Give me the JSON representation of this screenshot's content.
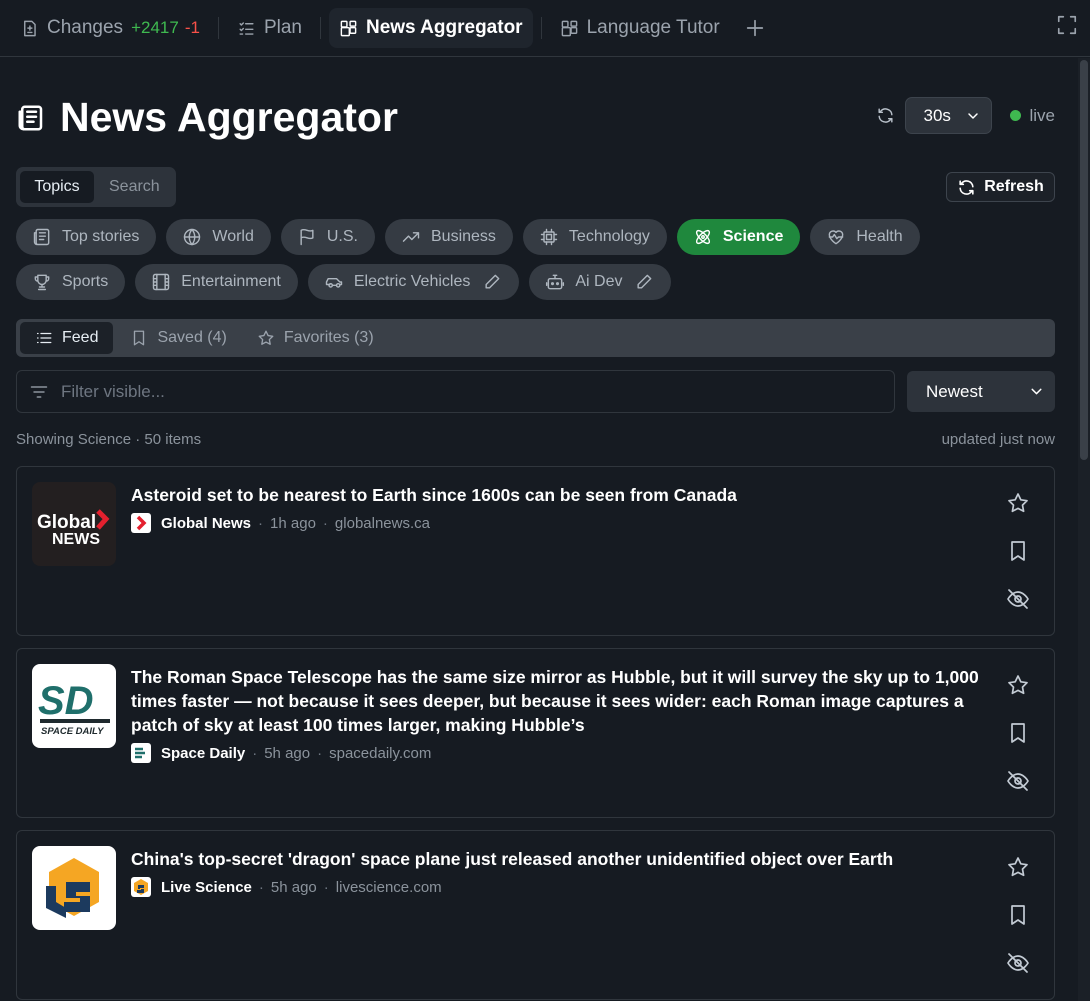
{
  "tabs": [
    {
      "label": "Changes",
      "additions": "+2417",
      "deletions": "-1"
    },
    {
      "label": "Plan"
    },
    {
      "label": "News Aggregator"
    },
    {
      "label": "Language Tutor"
    }
  ],
  "header": {
    "title": "News Aggregator",
    "interval": "30s",
    "live_label": "live"
  },
  "mode": {
    "topics": "Topics",
    "search": "Search"
  },
  "refresh_label": "Refresh",
  "topics": [
    {
      "label": "Top stories",
      "icon": "newspaper-icon"
    },
    {
      "label": "World",
      "icon": "globe-icon"
    },
    {
      "label": "U.S.",
      "icon": "flag-icon"
    },
    {
      "label": "Business",
      "icon": "trending-up-icon"
    },
    {
      "label": "Technology",
      "icon": "chip-icon"
    },
    {
      "label": "Science",
      "icon": "atom-icon",
      "active": true
    },
    {
      "label": "Health",
      "icon": "heart-pulse-icon"
    },
    {
      "label": "Sports",
      "icon": "trophy-icon"
    },
    {
      "label": "Entertainment",
      "icon": "film-icon"
    },
    {
      "label": "Electric Vehicles",
      "icon": "car-icon",
      "editable": true
    },
    {
      "label": "Ai Dev",
      "icon": "bot-icon",
      "editable": true
    }
  ],
  "view_tabs": {
    "feed": "Feed",
    "saved": "Saved (4)",
    "favorites": "Favorites (3)"
  },
  "filter": {
    "placeholder": "Filter visible...",
    "sort": "Newest"
  },
  "status": {
    "left": "Showing Science · 50 items",
    "right": "updated just now"
  },
  "articles": [
    {
      "title": "Asteroid set to be nearest to Earth since 1600s can be seen from Canada",
      "source": "Global News",
      "time": "1h ago",
      "domain": "globalnews.ca",
      "logo_text": [
        "Global",
        "NEWS"
      ]
    },
    {
      "title": "The Roman Space Telescope has the same size mirror as Hubble, but it will survey the sky up to 1,000 times faster — not because it sees deeper, but because it sees wider: each Roman image captures a patch of sky at least 100 times larger, making Hubble’s",
      "source": "Space Daily",
      "time": "5h ago",
      "domain": "spacedaily.com",
      "logo_text": [
        "SD",
        "SPACE DAILY"
      ]
    },
    {
      "title": "China's top-secret 'dragon' space plane just released another unidentified object over Earth",
      "source": "Live Science",
      "time": "5h ago",
      "domain": "livescience.com"
    }
  ],
  "colors": {
    "accent": "#1f883d",
    "live": "#3fb950",
    "additions": "#3fb950",
    "deletions": "#f85149"
  }
}
